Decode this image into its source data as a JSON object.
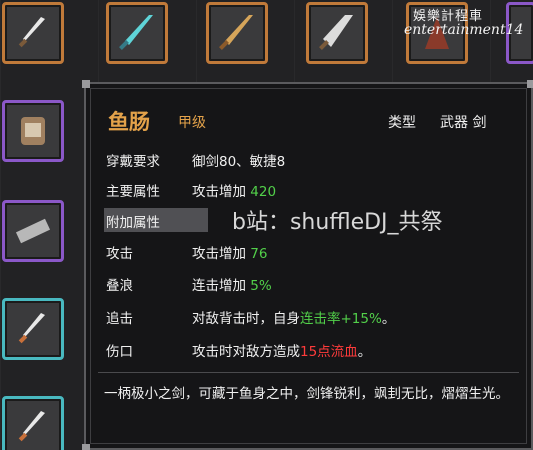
{
  "watermark": {
    "line1": "娛樂計程車",
    "line2": "entertainment14"
  },
  "item": {
    "name": "鱼肠",
    "grade": "甲级",
    "type_label": "类型",
    "type_value": "武器 剑",
    "requirement_label": "穿戴要求",
    "requirement_value": "御剑80、敏捷8",
    "main_attr_label": "主要属性",
    "main_attr_prefix": "攻击增加",
    "main_attr_num": "420",
    "extra_attr_label": "附加属性",
    "attack_label": "攻击",
    "attack_prefix": "攻击增加",
    "attack_num": "76",
    "stack_label": "叠浪",
    "stack_prefix": "连击增加",
    "stack_num": "5%",
    "chase_label": "追击",
    "chase_prefix": "对敌背击时，自身",
    "chase_green": "连击率+15%",
    "chase_suffix": "。",
    "wound_label": "伤口",
    "wound_prefix": "攻击时对敌方造成",
    "wound_red": "15点流血",
    "wound_suffix": "。",
    "description": "一柄极小之剑，可藏于鱼身之中，剑锋锐利，飒刲无比，熠熠生光。"
  },
  "overlay": {
    "bilibili": "b站：shuffleDJ_共祭"
  },
  "colors": {
    "gold": "#e3a24a",
    "green": "#52d04a",
    "red": "#ff3b3b",
    "orange_slot": "#c07a3a",
    "purple_slot": "#8b58c8",
    "teal_slot": "#49b9c0"
  }
}
